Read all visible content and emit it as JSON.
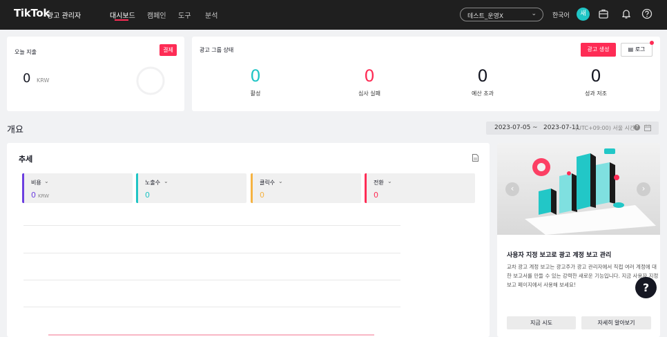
{
  "header": {
    "logo": "TikTok",
    "logo_sub": "광고 관리자",
    "nav": [
      "대시보드",
      "캠페인",
      "도구",
      "분석"
    ],
    "account": "테스트_운영X",
    "language": "한국어",
    "avatar_initial": "새"
  },
  "spend_card": {
    "title": "오늘 지출",
    "pay_button": "결제",
    "value": "0",
    "currency": "KRW"
  },
  "ad_group_status": {
    "title": "광고 그룹 상태",
    "create_button": "광고 생성",
    "log_button": "로그",
    "items": [
      {
        "value": "0",
        "label": "활성",
        "color": "#20c5c5"
      },
      {
        "value": "0",
        "label": "심사 실패",
        "color": "#fe2c55"
      },
      {
        "value": "0",
        "label": "예산 초과",
        "color": "#161823"
      },
      {
        "value": "0",
        "label": "성과 저조",
        "color": "#161823"
      }
    ]
  },
  "overview": {
    "title": "개요",
    "date_start": "2023-07-05",
    "date_sep": "~",
    "date_end": "2023-07-11",
    "timezone": "(UTC+09:00) 서울 시간"
  },
  "trend": {
    "title": "추세",
    "metrics": [
      {
        "label": "비용",
        "value": "0",
        "unit": "KRW",
        "color": "#6c3fe0"
      },
      {
        "label": "노출수",
        "value": "0",
        "unit": "",
        "color": "#20c5c5"
      },
      {
        "label": "클릭수",
        "value": "0",
        "unit": "",
        "color": "#f5b342"
      },
      {
        "label": "전환",
        "value": "0",
        "unit": "",
        "color": "#fe2c55"
      }
    ]
  },
  "promo": {
    "title": "사용자 지정 보고로 광고 계정 보고 관리",
    "text": "교차 광고 계정 보고는 광고주가 광고 관리자에서 직접 여러 계정에 대한 보고서를 만들 수 있는 강력한 새로운 기능입니다. 지금 사용자 지정 보고 페이지에서 사용해 보세요!",
    "try_button": "지금 시도",
    "learn_button": "자세히 알아보기"
  }
}
